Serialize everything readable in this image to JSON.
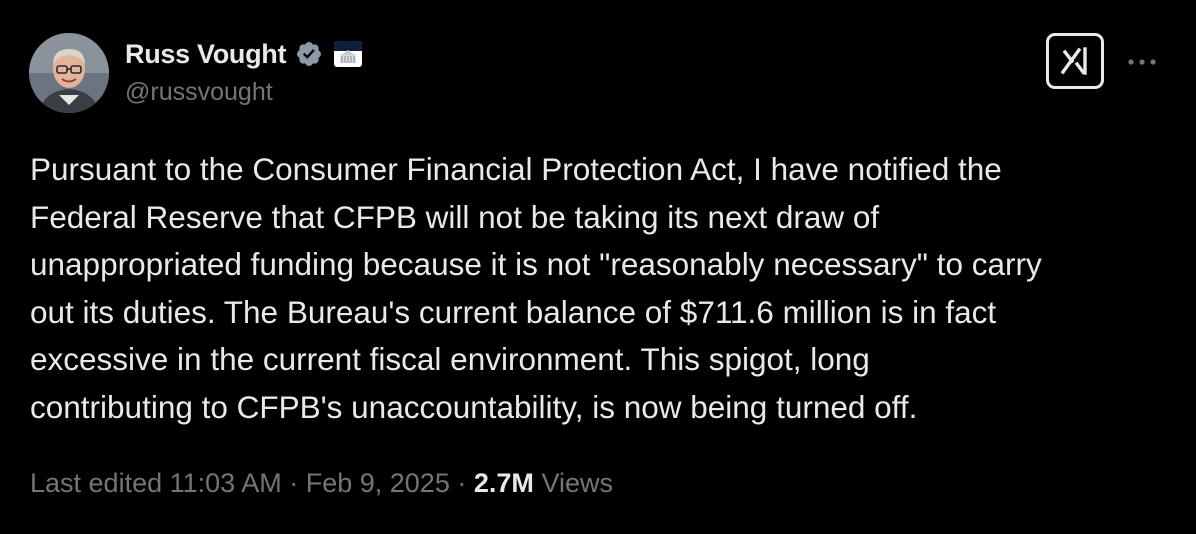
{
  "author": {
    "display_name": "Russ Vought",
    "handle": "@russvought",
    "verified_icon": "verified-badge-icon",
    "affiliation_icon": "white-house-icon"
  },
  "actions": {
    "grok_icon": "grok-icon",
    "more_icon": "more-horizontal-icon"
  },
  "tweet": {
    "lines": [
      "Pursuant to the Consumer Financial Protection Act, I have notified the",
      "Federal Reserve that CFPB will not be taking its next draw of",
      "unappropriated funding because it is not \"reasonably necessary\" to carry",
      "out its duties. The Bureau's current balance of $711.6 million is in fact",
      "excessive in the current fiscal environment. This spigot, long",
      "contributing to CFPB's unaccountability, is now being turned off."
    ]
  },
  "meta": {
    "edited_label": "Last edited",
    "time": "11:03 AM",
    "separator": "·",
    "date": "Feb 9, 2025",
    "views_count": "2.7M",
    "views_label": "Views"
  },
  "colors": {
    "background": "#000000",
    "text_primary": "#e7e9ea",
    "text_secondary": "#71767b",
    "verified_blue": "#8b98a5"
  }
}
